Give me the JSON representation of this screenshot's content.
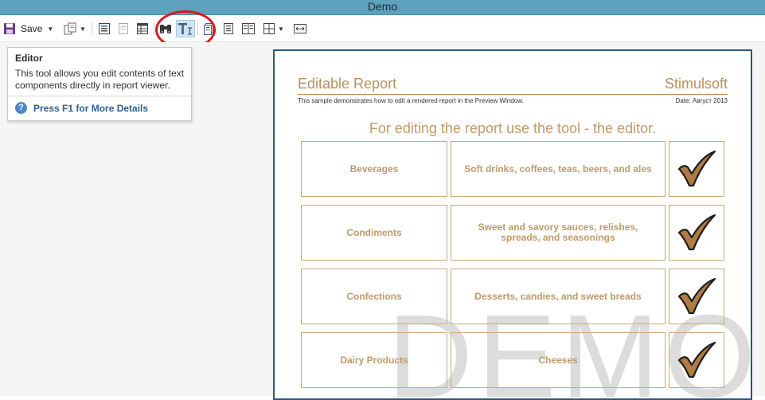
{
  "window": {
    "title": "Demo"
  },
  "toolbar": {
    "save_label": "Save",
    "save_caret": "▼",
    "export_caret": "▼",
    "pages_caret": "▼"
  },
  "tooltip": {
    "title": "Editor",
    "text": "This tool allows you edit contents of text components directly in report viewer.",
    "help_icon": "?",
    "help_label": "Press F1 for More Details"
  },
  "report": {
    "title": "Editable Report",
    "company": "Stimulsoft",
    "description": "This sample demonstrates how to edit a rendered report in the Preview Window.",
    "date": "Date: Август 2013",
    "heading": "For editing the report use the tool - the editor.",
    "watermark": "DEMO",
    "rows": [
      {
        "category": "Beverages",
        "description": "Soft drinks, coffees, teas, beers, and ales",
        "checked": true
      },
      {
        "category": "Condiments",
        "description": "Sweet and savory sauces, relishes, spreads, and seasonings",
        "checked": true
      },
      {
        "category": "Confections",
        "description": "Desserts, candies, and sweet breads",
        "checked": true
      },
      {
        "category": "Dairy Products",
        "description": "Cheeses",
        "checked": true
      }
    ]
  },
  "colors": {
    "titlebar": "#5ea1bd",
    "report_accent": "#b9905b",
    "highlight_circle": "#e0141e"
  }
}
